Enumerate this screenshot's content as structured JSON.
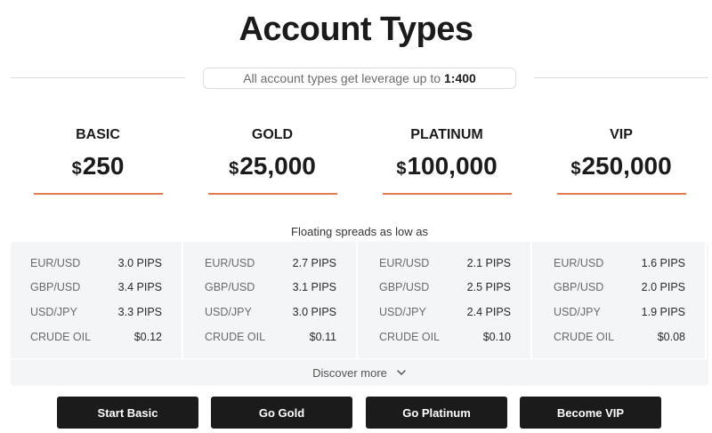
{
  "header": {
    "title": "Account Types",
    "leverage_text": "All account types get leverage up to",
    "leverage_value": "1:400"
  },
  "tiers": [
    {
      "name": "BASIC",
      "currency": "$",
      "amount": "250"
    },
    {
      "name": "GOLD",
      "currency": "$",
      "amount": "25,000"
    },
    {
      "name": "PLATINUM",
      "currency": "$",
      "amount": "100,000"
    },
    {
      "name": "VIP",
      "currency": "$",
      "amount": "250,000"
    }
  ],
  "spreads": {
    "caption": "Floating spreads as low as",
    "columns": [
      {
        "rows": [
          {
            "pair": "EUR/USD",
            "value": "3.0 PIPS"
          },
          {
            "pair": "GBP/USD",
            "value": "3.4 PIPS"
          },
          {
            "pair": "USD/JPY",
            "value": "3.3 PIPS"
          },
          {
            "pair": "CRUDE OIL",
            "value": "$0.12"
          }
        ]
      },
      {
        "rows": [
          {
            "pair": "EUR/USD",
            "value": "2.7 PIPS"
          },
          {
            "pair": "GBP/USD",
            "value": "3.1 PIPS"
          },
          {
            "pair": "USD/JPY",
            "value": "3.0 PIPS"
          },
          {
            "pair": "CRUDE OIL",
            "value": "$0.11"
          }
        ]
      },
      {
        "rows": [
          {
            "pair": "EUR/USD",
            "value": "2.1 PIPS"
          },
          {
            "pair": "GBP/USD",
            "value": "2.5 PIPS"
          },
          {
            "pair": "USD/JPY",
            "value": "2.4 PIPS"
          },
          {
            "pair": "CRUDE OIL",
            "value": "$0.10"
          }
        ]
      },
      {
        "rows": [
          {
            "pair": "EUR/USD",
            "value": "1.6 PIPS"
          },
          {
            "pair": "GBP/USD",
            "value": "2.0 PIPS"
          },
          {
            "pair": "USD/JPY",
            "value": "1.9 PIPS"
          },
          {
            "pair": "CRUDE OIL",
            "value": "$0.08"
          }
        ]
      }
    ],
    "discover_label": "Discover more",
    "discover_icon": "chevron-down-icon"
  },
  "buttons": [
    {
      "label": "Start Basic"
    },
    {
      "label": "Go Gold"
    },
    {
      "label": "Go Platinum"
    },
    {
      "label": "Become VIP"
    }
  ],
  "colors": {
    "accent": "#e07a4f",
    "button_bg": "#1b1b1b",
    "panel_bg": "#f4f5f7"
  }
}
